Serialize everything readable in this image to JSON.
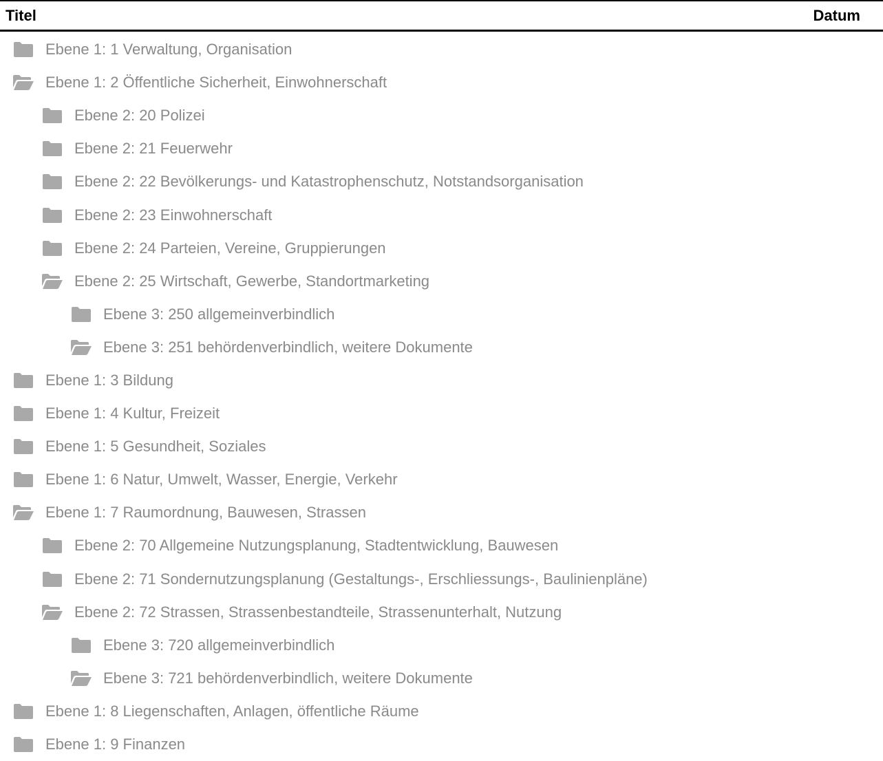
{
  "header": {
    "title_column": "Titel",
    "date_column": "Datum"
  },
  "colors": {
    "icon": "#a9a9a9",
    "text": "#8a8a8a",
    "rule": "#000000"
  },
  "tree": [
    {
      "level": 1,
      "state": "closed",
      "icon": "folder-icon",
      "label": "Ebene 1: 1 Verwaltung, Organisation"
    },
    {
      "level": 1,
      "state": "open",
      "icon": "folder-open-icon",
      "label": "Ebene 1: 2 Öffentliche Sicherheit, Einwohnerschaft"
    },
    {
      "level": 2,
      "state": "closed",
      "icon": "folder-icon",
      "label": "Ebene 2: 20 Polizei"
    },
    {
      "level": 2,
      "state": "closed",
      "icon": "folder-icon",
      "label": "Ebene 2: 21 Feuerwehr"
    },
    {
      "level": 2,
      "state": "closed",
      "icon": "folder-icon",
      "label": "Ebene 2: 22 Bevölkerungs- und Katastrophenschutz, Notstandsorganisation"
    },
    {
      "level": 2,
      "state": "closed",
      "icon": "folder-icon",
      "label": "Ebene 2: 23 Einwohnerschaft"
    },
    {
      "level": 2,
      "state": "closed",
      "icon": "folder-icon",
      "label": "Ebene 2: 24 Parteien, Vereine, Gruppierungen"
    },
    {
      "level": 2,
      "state": "open",
      "icon": "folder-open-icon",
      "label": "Ebene 2: 25 Wirtschaft, Gewerbe, Standortmarketing"
    },
    {
      "level": 3,
      "state": "closed",
      "icon": "folder-icon",
      "label": "Ebene 3: 250 allgemeinverbindlich"
    },
    {
      "level": 3,
      "state": "open",
      "icon": "folder-open-icon",
      "label": "Ebene 3: 251 behördenverbindlich, weitere Dokumente"
    },
    {
      "level": 1,
      "state": "closed",
      "icon": "folder-icon",
      "label": "Ebene 1: 3 Bildung"
    },
    {
      "level": 1,
      "state": "closed",
      "icon": "folder-icon",
      "label": "Ebene 1: 4 Kultur, Freizeit"
    },
    {
      "level": 1,
      "state": "closed",
      "icon": "folder-icon",
      "label": "Ebene 1: 5 Gesundheit, Soziales"
    },
    {
      "level": 1,
      "state": "closed",
      "icon": "folder-icon",
      "label": "Ebene 1: 6 Natur, Umwelt, Wasser, Energie, Verkehr"
    },
    {
      "level": 1,
      "state": "open",
      "icon": "folder-open-icon",
      "label": "Ebene 1: 7 Raumordnung, Bauwesen, Strassen"
    },
    {
      "level": 2,
      "state": "closed",
      "icon": "folder-icon",
      "label": "Ebene 2: 70 Allgemeine Nutzungsplanung, Stadtentwicklung, Bauwesen"
    },
    {
      "level": 2,
      "state": "closed",
      "icon": "folder-icon",
      "label": "Ebene 2: 71 Sondernutzungsplanung (Gestaltungs-, Erschliessungs-, Baulinienpläne)"
    },
    {
      "level": 2,
      "state": "open",
      "icon": "folder-open-icon",
      "label": "Ebene 2: 72 Strassen, Strassenbestandteile, Strassenunterhalt, Nutzung"
    },
    {
      "level": 3,
      "state": "closed",
      "icon": "folder-icon",
      "label": "Ebene 3: 720 allgemeinverbindlich"
    },
    {
      "level": 3,
      "state": "open",
      "icon": "folder-open-icon",
      "label": "Ebene 3: 721 behördenverbindlich, weitere Dokumente"
    },
    {
      "level": 1,
      "state": "closed",
      "icon": "folder-icon",
      "label": "Ebene 1: 8 Liegenschaften, Anlagen, öffentliche Räume"
    },
    {
      "level": 1,
      "state": "closed",
      "icon": "folder-icon",
      "label": "Ebene 1: 9 Finanzen"
    }
  ]
}
